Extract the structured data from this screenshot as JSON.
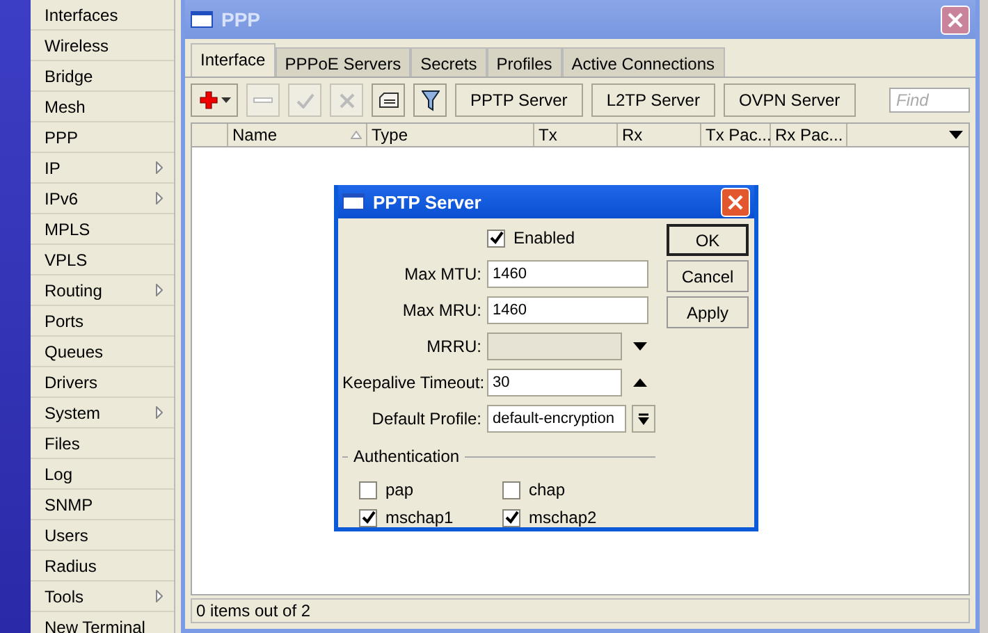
{
  "sidebar": {
    "items": [
      {
        "label": "Interfaces",
        "submenu": false
      },
      {
        "label": "Wireless",
        "submenu": false
      },
      {
        "label": "Bridge",
        "submenu": false
      },
      {
        "label": "Mesh",
        "submenu": false
      },
      {
        "label": "PPP",
        "submenu": false
      },
      {
        "label": "IP",
        "submenu": true
      },
      {
        "label": "IPv6",
        "submenu": true
      },
      {
        "label": "MPLS",
        "submenu": false
      },
      {
        "label": "VPLS",
        "submenu": false
      },
      {
        "label": "Routing",
        "submenu": true
      },
      {
        "label": "Ports",
        "submenu": false
      },
      {
        "label": "Queues",
        "submenu": false
      },
      {
        "label": "Drivers",
        "submenu": false
      },
      {
        "label": "System",
        "submenu": true
      },
      {
        "label": "Files",
        "submenu": false
      },
      {
        "label": "Log",
        "submenu": false
      },
      {
        "label": "SNMP",
        "submenu": false
      },
      {
        "label": "Users",
        "submenu": false
      },
      {
        "label": "Radius",
        "submenu": false
      },
      {
        "label": "Tools",
        "submenu": true
      },
      {
        "label": "New Terminal",
        "submenu": false
      }
    ]
  },
  "window": {
    "title": "PPP",
    "tabs": [
      {
        "label": "Interface",
        "selected": true
      },
      {
        "label": "PPPoE Servers",
        "selected": false
      },
      {
        "label": "Secrets",
        "selected": false
      },
      {
        "label": "Profiles",
        "selected": false
      },
      {
        "label": "Active Connections",
        "selected": false
      }
    ],
    "toolbar": {
      "icon_buttons": [
        {
          "kind": "add",
          "disabled": false
        },
        {
          "kind": "remove",
          "disabled": true
        },
        {
          "kind": "enable",
          "disabled": true
        },
        {
          "kind": "disable",
          "disabled": true
        },
        {
          "kind": "comment",
          "disabled": false
        },
        {
          "kind": "filter",
          "disabled": false
        }
      ],
      "buttons": [
        "PPTP Server",
        "L2TP Server",
        "OVPN Server"
      ],
      "find": {
        "placeholder": "Find"
      }
    },
    "table": {
      "columns": [
        {
          "label": "Name",
          "sorted": true
        },
        {
          "label": "Type",
          "sorted": false
        },
        {
          "label": "Tx",
          "sorted": false
        },
        {
          "label": "Rx",
          "sorted": false
        },
        {
          "label": "Tx Pac...",
          "sorted": false
        },
        {
          "label": "Rx Pac...",
          "sorted": false
        }
      ]
    },
    "status_bar": "0 items out of 2"
  },
  "dialog": {
    "title": "PPTP Server",
    "enabled": {
      "label": "Enabled",
      "checked": true
    },
    "fields": [
      {
        "kind": "text",
        "label": "Max MTU:",
        "value": "1460"
      },
      {
        "kind": "text",
        "label": "Max MRU:",
        "value": "1460"
      },
      {
        "kind": "toggle",
        "label": "MRRU:",
        "disabled": true
      },
      {
        "kind": "toggle",
        "label": "Keepalive Timeout:",
        "value": "30",
        "disabled": false
      },
      {
        "kind": "select",
        "label": "Default Profile:",
        "value": "default-encryption"
      }
    ],
    "buttons": [
      {
        "label": "OK",
        "default": true
      },
      {
        "label": "Cancel",
        "default": false
      },
      {
        "label": "Apply",
        "default": false
      }
    ],
    "authentication": {
      "label": "Authentication",
      "options": [
        {
          "label": "pap",
          "checked": false
        },
        {
          "label": "chap",
          "checked": false
        },
        {
          "label": "mschap1",
          "checked": true
        },
        {
          "label": "mschap2",
          "checked": true
        }
      ]
    }
  }
}
